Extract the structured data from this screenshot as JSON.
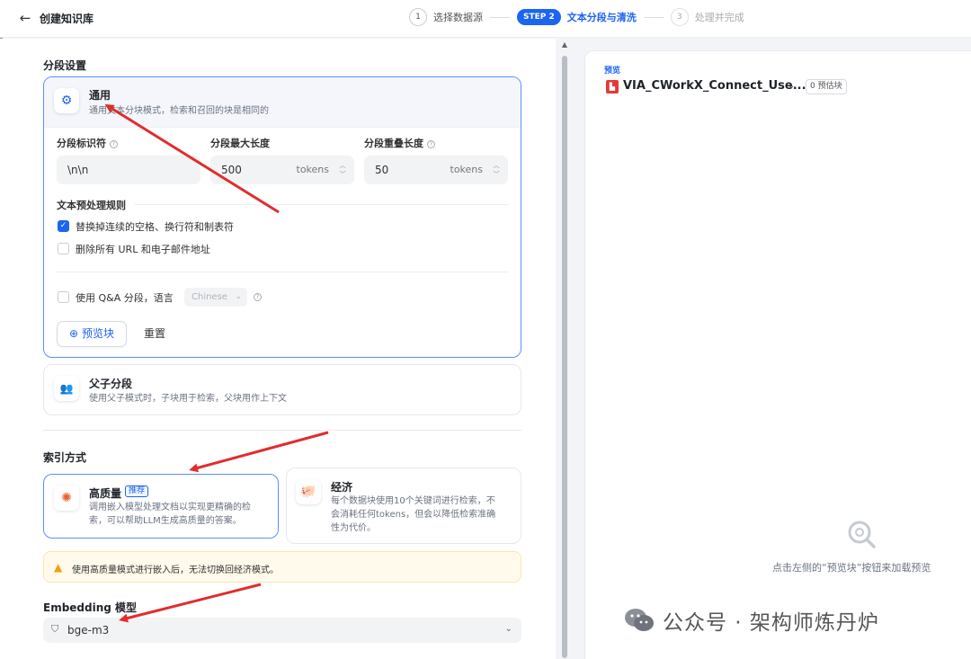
{
  "header": {
    "back_icon": "arrow-left-icon",
    "title": "创建知识库",
    "steps": [
      {
        "num": "1",
        "label": "选择数据源",
        "state": "done"
      },
      {
        "num": "STEP 2",
        "label": "文本分段与清洗",
        "state": "active"
      },
      {
        "num": "3",
        "label": "处理并完成",
        "state": "pending"
      }
    ]
  },
  "segment": {
    "section_title": "分段设置",
    "general": {
      "title": "通用",
      "desc": "通用文本分块模式，检索和召回的块是相同的",
      "icon": "gear-icon"
    },
    "fields": {
      "separator_label": "分段标识符",
      "separator_value": "\\n\\n",
      "maxlen_label": "分段最大长度",
      "maxlen_value": "500",
      "overlap_label": "分段重叠长度",
      "overlap_value": "50",
      "unit": "tokens"
    },
    "rules": {
      "title": "文本预处理规则",
      "items": [
        {
          "label": "替换掉连续的空格、换行符和制表符",
          "checked": true
        },
        {
          "label": "删除所有 URL 和电子邮件地址",
          "checked": false
        }
      ]
    },
    "qa": {
      "label": "使用 Q&A 分段，语言",
      "language": "Chinese",
      "checked": false
    },
    "preview_button": "预览块",
    "reset_button": "重置",
    "parent_child": {
      "title": "父子分段",
      "desc": "使用父子模式时，子块用于检索，父块用作上下文",
      "icon": "parent-child-icon"
    }
  },
  "index": {
    "section_title": "索引方式",
    "high_quality": {
      "title": "高质量",
      "badge": "推荐",
      "desc_line1": "调用嵌入模型处理文档以实现更精确的检",
      "desc_line2": "索，可以帮助LLM生成高质量的答案。",
      "icon": "sparkle-icon"
    },
    "economy": {
      "title": "经济",
      "desc_line1": "每个数据块使用10个关键词进行检索，不",
      "desc_line2": "会消耗任何tokens，但会以降低检索准确",
      "desc_line3": "性为代价。",
      "icon": "piggy-bank-icon"
    },
    "warning": "使用高质量模式进行嵌入后，无法切换回经济模式。"
  },
  "embedding": {
    "title": "Embedding 模型",
    "value": "bge-m3"
  },
  "preview": {
    "label": "预览",
    "file_name": "VIA_CWorkX_Connect_Use...",
    "chunk_count": "0 预估块",
    "empty_text": "点击左侧的“预览块”按钮来加载预览"
  },
  "watermark": {
    "text": "公众号 · 架构师炼丹炉"
  },
  "colors": {
    "accent": "#1c64f2",
    "arrow": "#e02d2d",
    "warning": "#f59e0b"
  }
}
